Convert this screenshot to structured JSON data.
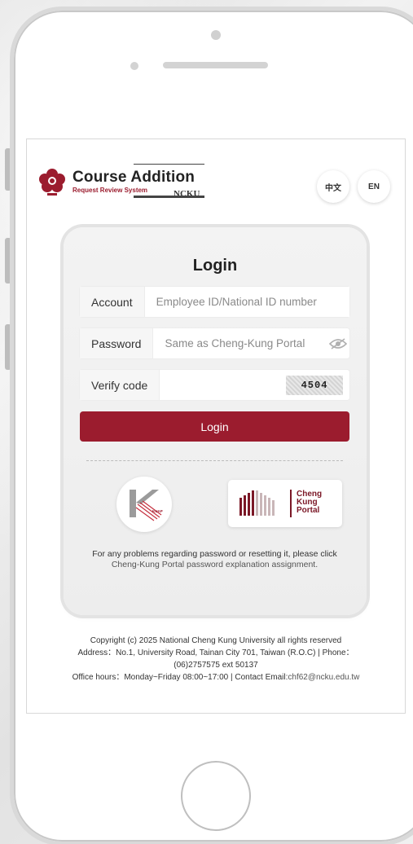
{
  "header": {
    "brand_title": "Course Addition",
    "brand_subtitle": "Request Review System",
    "brand_org": "NCKU",
    "lang_zh": "中文",
    "lang_en": "EN"
  },
  "login": {
    "title": "Login",
    "account_label": "Account",
    "account_placeholder": "Employee ID/National ID number",
    "password_label": "Password",
    "password_placeholder": "Same as Cheng-Kung Portal",
    "verify_label": "Verify code",
    "captcha_code": "4504",
    "submit_label": "Login"
  },
  "links": {
    "kuap_label": "KUAP",
    "portal_line1": "Cheng",
    "portal_line2": "Kung",
    "portal_line3": "Portal"
  },
  "help": {
    "text": "For any problems regarding password or resetting it, please click",
    "link": "Cheng-Kung Portal password explanation assignment."
  },
  "footer": {
    "copyright": "Copyright (c) 2025 National Cheng Kung University all rights reserved",
    "address": "Address：No.1, University Road, Tainan City 701, Taiwan (R.O.C)  | Phone：(06)2757575 ext 50137",
    "hours": "Office hours：Monday~Friday 08:00~17:00  |  Contact Email:",
    "email": "chf62@ncku.edu.tw"
  },
  "colors": {
    "accent": "#9b1c2e",
    "background": "#ffffff"
  },
  "icons": [
    "ncku-logo-icon",
    "eye-icon",
    "kuap-logo-icon",
    "portal-logo-icon"
  ]
}
